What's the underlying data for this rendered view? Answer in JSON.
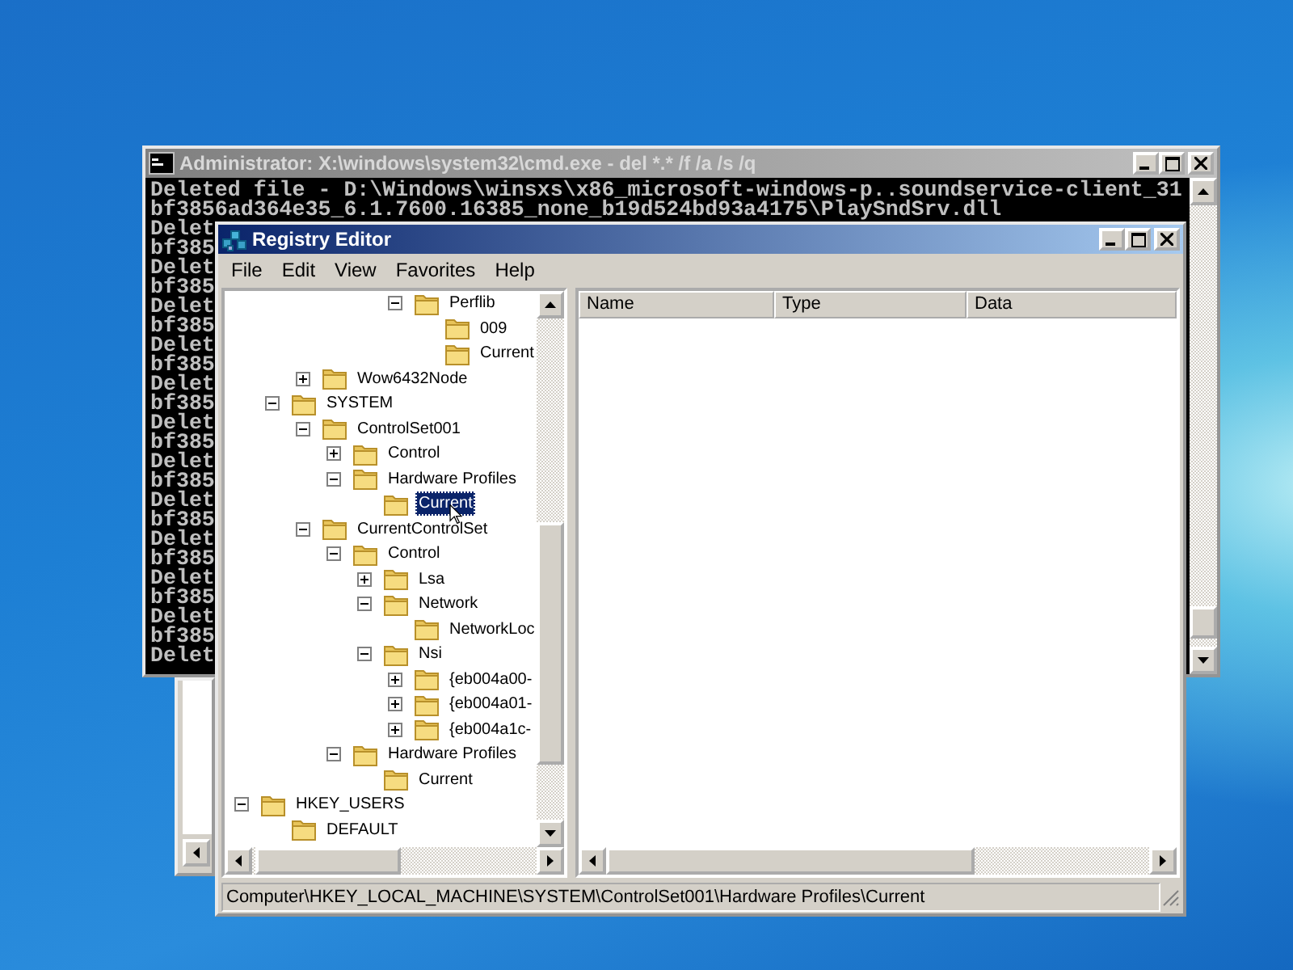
{
  "console_window": {
    "title": "Administrator: X:\\windows\\system32\\cmd.exe - del *.* /f /a /s /q",
    "lines": [
      "Deleted file - D:\\Windows\\winsxs\\x86_microsoft-windows-p..soundservice-client_31",
      "bf3856ad364e35_6.1.7600.16385_none_b19d524bd93a4175\\PlaySndSrv.dll",
      "Delet",
      "bf385",
      "Delet",
      "bf385",
      "Delet",
      "bf385",
      "Delet",
      "bf385",
      "Delet",
      "bf385",
      "Delet",
      "bf385",
      "Delet",
      "bf385",
      "Delet",
      "bf385",
      "Delet",
      "bf385",
      "Delet",
      "bf385",
      "Delet",
      "bf385",
      "Delet"
    ]
  },
  "registry_editor": {
    "title": "Registry Editor",
    "menu": [
      "File",
      "Edit",
      "View",
      "Favorites",
      "Help"
    ],
    "tree": [
      {
        "children": [
          {
            "children": [
              {
                "children": [
                  {
                    "children": [
                      {
                        "children": [
                          {
                            "label": "Perflib",
                            "expanded": true,
                            "selected": false,
                            "children": [
                              {
                                "label": "009",
                                "selected": false
                              },
                              {
                                "label": "Current",
                                "selected": false
                              }
                            ]
                          }
                        ]
                      }
                    ]
                  }
                ]
              },
              {
                "label": "Wow6432Node",
                "expanded": false,
                "selected": false
              }
            ]
          },
          {
            "label": "SYSTEM",
            "expanded": true,
            "selected": false,
            "children": [
              {
                "label": "ControlSet001",
                "expanded": true,
                "selected": false,
                "children": [
                  {
                    "label": "Control",
                    "expanded": false,
                    "selected": false
                  },
                  {
                    "label": "Hardware Profiles",
                    "expanded": true,
                    "selected": false,
                    "children": [
                      {
                        "label": "Current",
                        "selected": true
                      }
                    ]
                  }
                ]
              },
              {
                "label": "CurrentControlSet",
                "expanded": true,
                "selected": false,
                "children": [
                  {
                    "label": "Control",
                    "expanded": true,
                    "selected": false,
                    "children": [
                      {
                        "label": "Lsa",
                        "expanded": false,
                        "selected": false
                      },
                      {
                        "label": "Network",
                        "expanded": true,
                        "selected": false,
                        "children": [
                          {
                            "label": "NetworkLoc",
                            "selected": false
                          }
                        ]
                      },
                      {
                        "label": "Nsi",
                        "expanded": true,
                        "selected": false,
                        "children": [
                          {
                            "label": "{eb004a00-",
                            "expanded": false,
                            "selected": false
                          },
                          {
                            "label": "{eb004a01-",
                            "expanded": false,
                            "selected": false
                          },
                          {
                            "label": "{eb004a1c-",
                            "expanded": false,
                            "selected": false
                          }
                        ]
                      }
                    ]
                  },
                  {
                    "label": "Hardware Profiles",
                    "expanded": true,
                    "selected": false,
                    "children": [
                      {
                        "label": "Current",
                        "selected": false
                      }
                    ]
                  }
                ]
              }
            ]
          }
        ]
      },
      {
        "label": "HKEY_USERS",
        "expanded": true,
        "selected": false,
        "children": [
          {
            "label": "DEFAULT",
            "selected": false
          }
        ]
      }
    ],
    "columns": [
      "Name",
      "Type",
      "Data"
    ],
    "status_bar": "Computer\\HKEY_LOCAL_MACHINE\\SYSTEM\\ControlSet001\\Hardware Profiles\\Current"
  }
}
